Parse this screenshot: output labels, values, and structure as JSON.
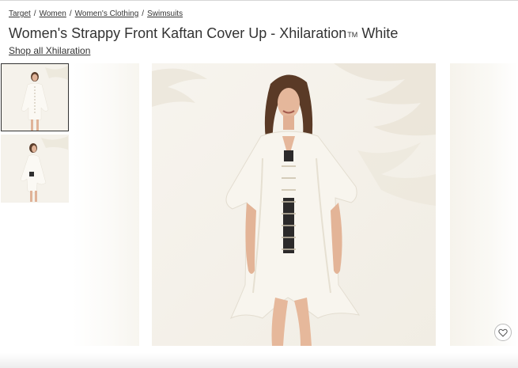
{
  "breadcrumb": {
    "items": [
      "Target",
      "Women",
      "Women's Clothing",
      "Swimsuits"
    ],
    "separator": "/"
  },
  "product": {
    "title": "Women's Strappy Front Kaftan Cover Up - Xhilaration",
    "trademark": "TM",
    "color_name": "White",
    "shop_all_link": "Shop all Xhilaration"
  },
  "gallery": {
    "thumbnails": [
      "model front view",
      "model side view"
    ],
    "selected_index": 0,
    "main_image": "model wearing white kaftan cover up, front view"
  },
  "icons": {
    "favorite": "heart-icon"
  },
  "colors": {
    "text": "#333333",
    "image_background": "#f5f2eb",
    "garment": "#f8f5ee"
  }
}
